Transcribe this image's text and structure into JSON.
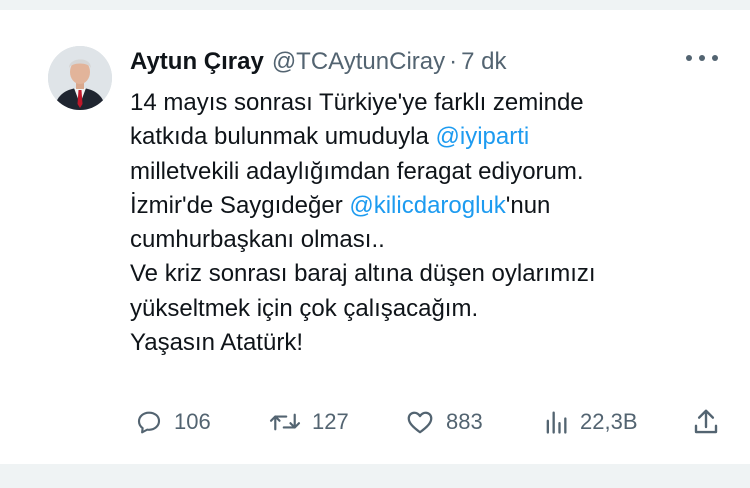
{
  "author": {
    "name": "Aytun Çıray",
    "handle": "@TCAytunCiray",
    "separator": "·",
    "time": "7 dk"
  },
  "tweet": {
    "lines": [
      [
        {
          "t": "14 mayıs sonrası Türkiye'ye farklı zeminde",
          "mention": false
        }
      ],
      [
        {
          "t": "katkıda bulunmak umuduyla ",
          "mention": false
        },
        {
          "t": "@iyiparti",
          "mention": true
        }
      ],
      [
        {
          "t": "milletvekili adaylığımdan feragat ediyorum.",
          "mention": false
        }
      ],
      [
        {
          "t": "İzmir'de Saygıdeğer ",
          "mention": false
        },
        {
          "t": "@kilicdarogluk",
          "mention": true
        },
        {
          "t": "'nun",
          "mention": false
        }
      ],
      [
        {
          "t": "cumhurbaşkanı olması..",
          "mention": false
        }
      ],
      [
        {
          "t": "Ve kriz sonrası baraj altına düşen oylarımızı",
          "mention": false
        }
      ],
      [
        {
          "t": "yükseltmek için çok çalışacağım.",
          "mention": false
        }
      ],
      [
        {
          "t": "Yaşasın Atatürk!",
          "mention": false
        }
      ]
    ]
  },
  "actions": {
    "reply": {
      "icon": "reply-icon",
      "count": "106"
    },
    "retweet": {
      "icon": "retweet-icon",
      "count": "127"
    },
    "like": {
      "icon": "heart-icon",
      "count": "883"
    },
    "views": {
      "icon": "views-icon",
      "count": "22,3B"
    },
    "share": {
      "icon": "share-icon"
    }
  },
  "colors": {
    "text": "#0f1419",
    "secondary": "#536471",
    "mention": "#1d9bf0",
    "divider": "#eff3f4"
  }
}
